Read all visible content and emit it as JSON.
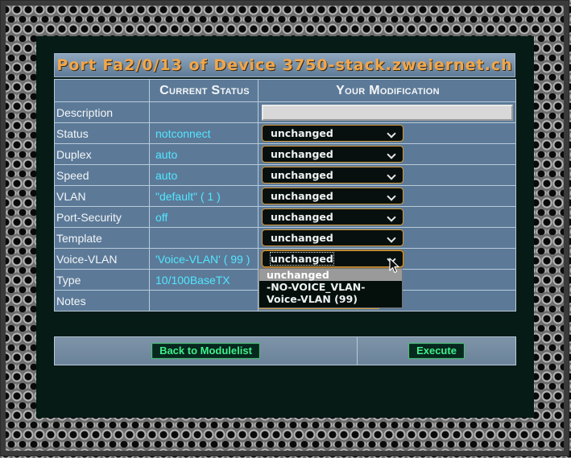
{
  "title": "Port Fa2/0/13 of Device 3750-stack.zweiernet.ch",
  "headers": {
    "blank": "",
    "current": "Current Status",
    "modification": "Your Modification"
  },
  "rows": [
    {
      "label": "Description",
      "current": "",
      "control": "textbox",
      "value": ""
    },
    {
      "label": "Status",
      "current": "notconnect",
      "control": "select",
      "value": "unchanged"
    },
    {
      "label": "Duplex",
      "current": "auto",
      "control": "select",
      "value": "unchanged"
    },
    {
      "label": "Speed",
      "current": "auto",
      "control": "select",
      "value": "unchanged"
    },
    {
      "label": "VLAN",
      "current": "\"default\" ( 1 )",
      "control": "select",
      "value": "unchanged"
    },
    {
      "label": "Port-Security",
      "current": "off",
      "control": "select",
      "value": "unchanged"
    },
    {
      "label": "Template",
      "current": "",
      "control": "select",
      "value": "unchanged"
    },
    {
      "label": "Voice-VLAN",
      "current": "'Voice-VLAN' ( 99 )",
      "control": "select",
      "value": "unchanged",
      "open": true
    },
    {
      "label": "Type",
      "current": "10/100BaseTX",
      "control": "none",
      "value": ""
    },
    {
      "label": "Notes",
      "current": "",
      "control": "none",
      "value": ""
    }
  ],
  "voice_vlan_options": [
    "unchanged",
    "-NO-VOICE_VLAN-",
    "Voice-VLAN (99)"
  ],
  "voice_vlan_highlighted": "unchanged",
  "buttons": {
    "back": "Back to Modulelist",
    "execute": "Execute"
  },
  "colors": {
    "title": "#f2a64a",
    "current_status": "#52e6ff",
    "button_text": "#3ff08a",
    "select_border": "#d59a3c"
  },
  "icons": {
    "select_arrow": "chevron-down-icon",
    "pointer": "mouse-cursor-icon"
  }
}
